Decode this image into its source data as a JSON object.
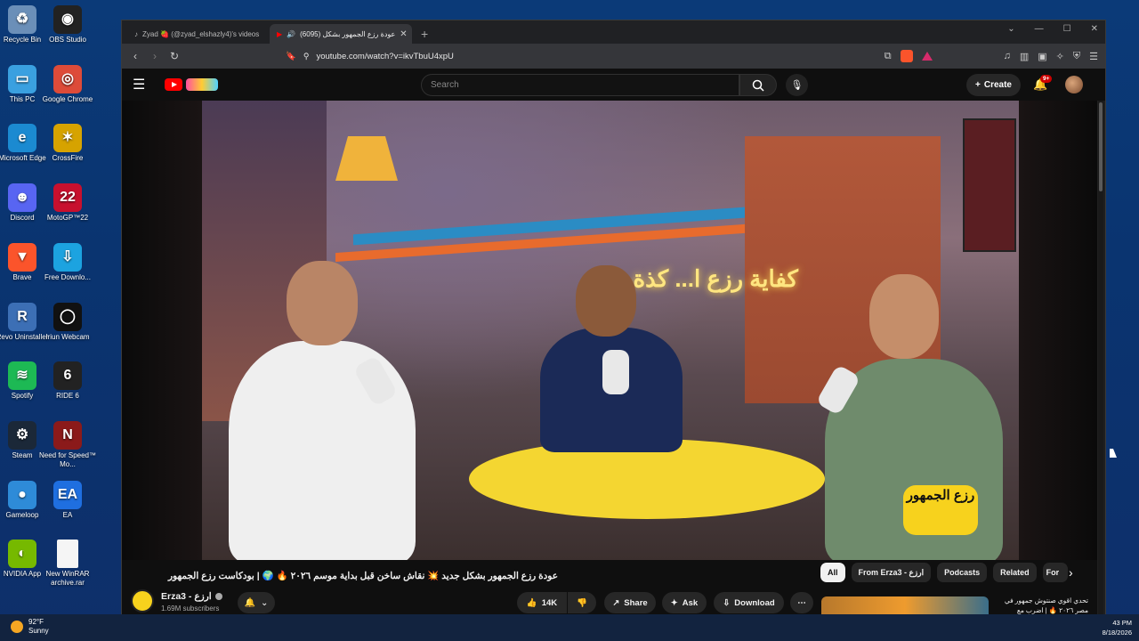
{
  "desktop": {
    "icons": [
      {
        "label": "Recycle Bin",
        "icon": "recycle-bin-icon",
        "color": "#6b8fb8",
        "glyph": "♻"
      },
      {
        "label": "OBS Studio",
        "icon": "obs-icon",
        "color": "#222222",
        "glyph": "◉"
      },
      {
        "label": "This PC",
        "icon": "pc-icon",
        "color": "#3aa0e0",
        "glyph": "▭"
      },
      {
        "label": "Google Chrome",
        "icon": "chrome-icon",
        "color": "#dd4b39",
        "glyph": "◎"
      },
      {
        "label": "Microsoft Edge",
        "icon": "edge-icon",
        "color": "#1b8ad1",
        "glyph": "e"
      },
      {
        "label": "CrossFire",
        "icon": "crossfire-icon",
        "color": "#d6a300",
        "glyph": "✶"
      },
      {
        "label": "Discord",
        "icon": "discord-icon",
        "color": "#5865f2",
        "glyph": "☻"
      },
      {
        "label": "MotoGP™22",
        "icon": "motogp-icon",
        "color": "#c8102e",
        "glyph": "22"
      },
      {
        "label": "Brave",
        "icon": "brave-icon",
        "color": "#fb542b",
        "glyph": "▼"
      },
      {
        "label": "Free Downlo...",
        "icon": "fdm-icon",
        "color": "#1ca3e0",
        "glyph": "⇩"
      },
      {
        "label": "Revo Uninstaller",
        "icon": "revo-icon",
        "color": "#3c6fb5",
        "glyph": "R"
      },
      {
        "label": "Iriun Webcam",
        "icon": "iriun-icon",
        "color": "#111111",
        "glyph": "◯"
      },
      {
        "label": "Spotify",
        "icon": "spotify-icon",
        "color": "#1db954",
        "glyph": "≋"
      },
      {
        "label": "RIDE 6",
        "icon": "ride-icon",
        "color": "#222222",
        "glyph": "6"
      },
      {
        "label": "Steam",
        "icon": "steam-icon",
        "color": "#1b2838",
        "glyph": "⚙"
      },
      {
        "label": "Need for Speed™ Mo...",
        "icon": "nfs-icon",
        "color": "#8b1a1a",
        "glyph": "N"
      },
      {
        "label": "Gameloop",
        "icon": "gameloop-icon",
        "color": "#2e8bd8",
        "glyph": "●"
      },
      {
        "label": "EA",
        "icon": "ea-icon",
        "color": "#1f6fe0",
        "glyph": "EA"
      },
      {
        "label": "NVIDIA App",
        "icon": "nvidia-icon",
        "color": "#76b900",
        "glyph": "◐"
      },
      {
        "label": "New WinRAR archive.rar",
        "icon": "file-icon",
        "color": "#f5f5f5",
        "glyph": " "
      }
    ]
  },
  "browser": {
    "tabs": [
      {
        "label": "Zyad 🍓 (@zyad_elshazly4)'s videos",
        "icon": "tiktok-icon"
      },
      {
        "label": "(6095) عودة رزع الجمهور بشكل",
        "icon": "youtube-icon"
      }
    ],
    "new_tab": "+",
    "url": "youtube.com/watch?v=ikvTbuU4xpU"
  },
  "youtube": {
    "search_placeholder": "Search",
    "create_label": "Create",
    "notif_count": "9+",
    "video_overlay_text": "كفاية رزع ا... كذة..",
    "logo_badge_text": "رزع الجمهور",
    "video_title": "عودة رزع الجمهور بشكل جديد 💥 نقاش ساخن قبل بداية موسم ٢٠٢٦ 🔥 🌍 | بودكاست رزع الجمهور",
    "channel_name": "Erza3 - ارزع",
    "subscribers": "1.69M subscribers",
    "likes": "14K",
    "share_label": "Share",
    "ask_label": "Ask",
    "download_label": "Download",
    "chips": [
      "All",
      "From Erza3 - ارزع",
      "Podcasts",
      "Related",
      "For"
    ],
    "rec_title": "تحدي اقوي صنتوش جمهور في مصر ٢٠٢٦ 🔥 | اضرب مع"
  },
  "taskbar": {
    "temperature": "92°F",
    "condition": "Sunny",
    "time": "43 PM",
    "date": "8/18/2026"
  }
}
